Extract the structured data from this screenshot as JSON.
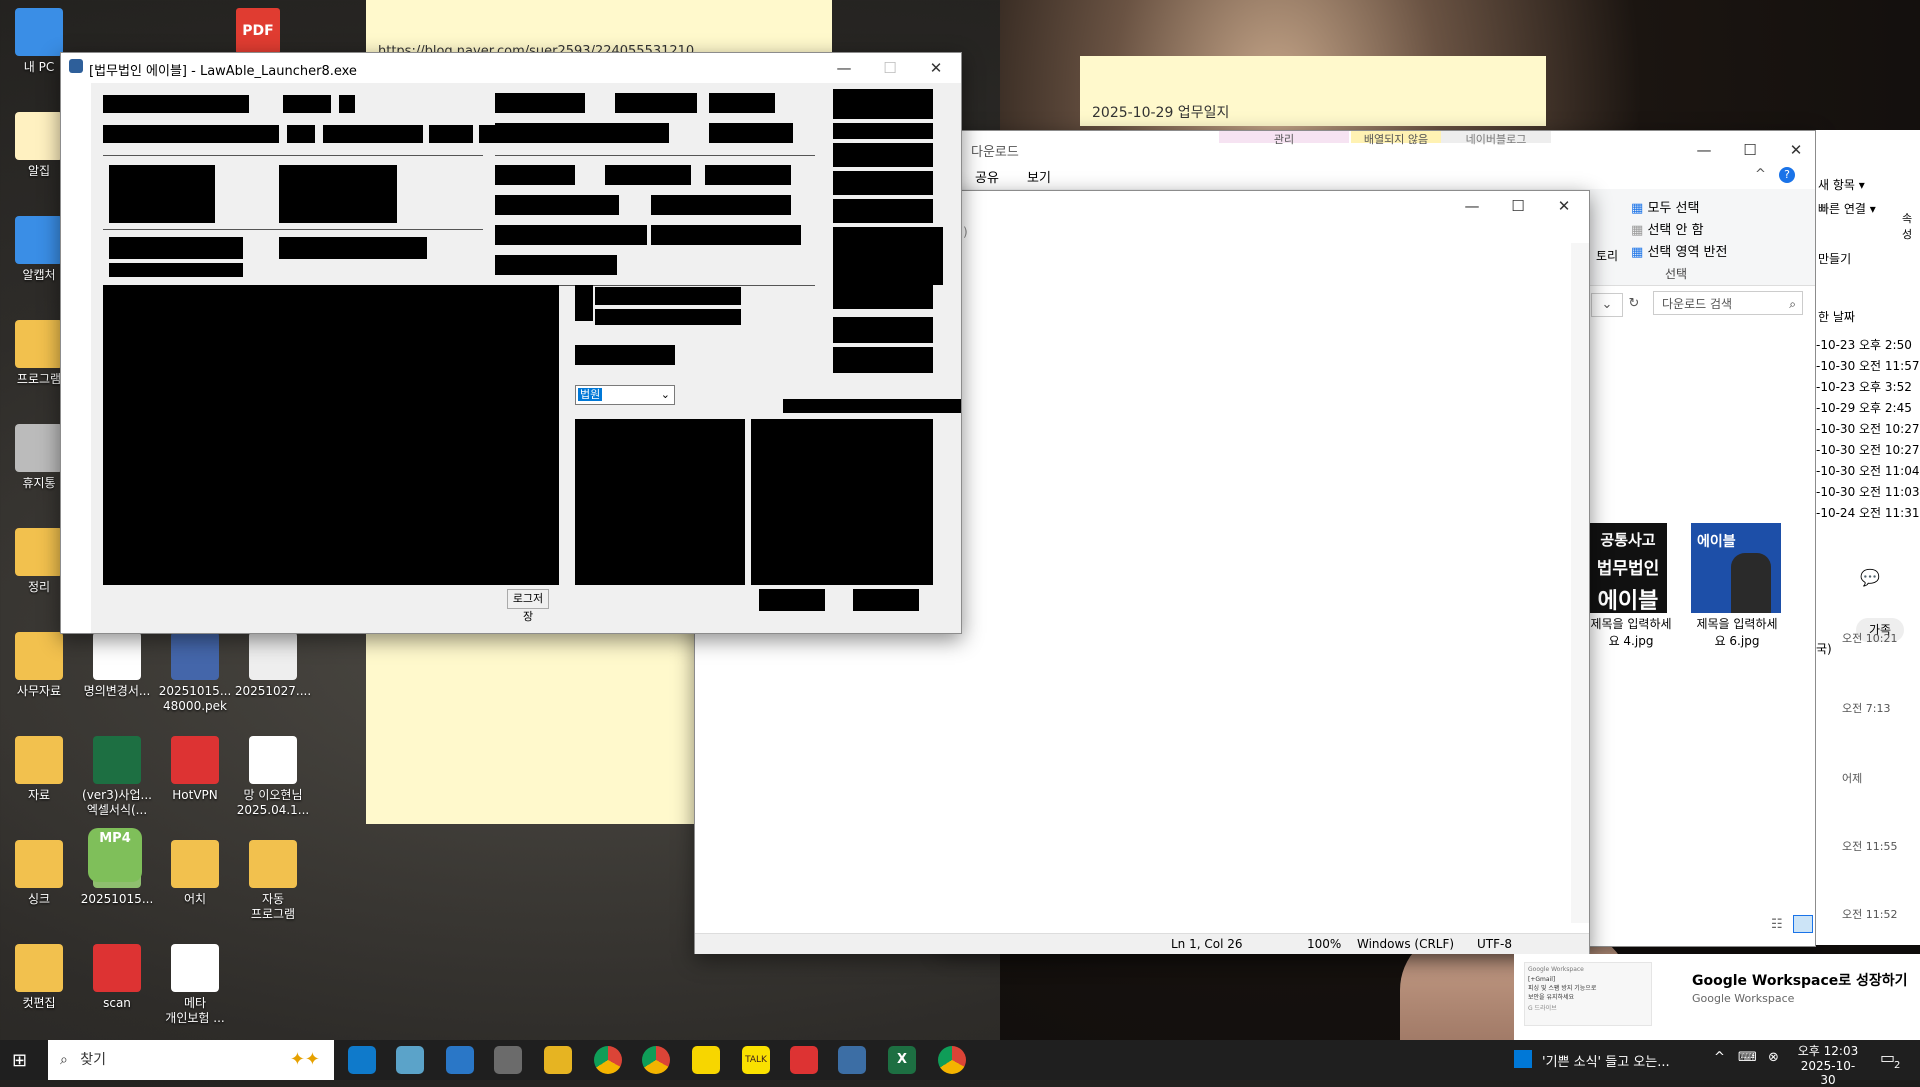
{
  "desktop": {
    "icons": [
      {
        "label": "내 PC"
      },
      {
        "label": "알집"
      },
      {
        "label": "알캡처"
      },
      {
        "label": "프로그램"
      },
      {
        "label": "휴지통"
      },
      {
        "label": "정리"
      },
      {
        "label": "사무자료"
      },
      {
        "label": "자료"
      },
      {
        "label": "싱크"
      },
      {
        "label": "컷편집"
      },
      {
        "label": "명의변경서..."
      },
      {
        "label": "(ver3)사업...\n엑셀서식(..."
      },
      {
        "label": "20251015..."
      },
      {
        "label": "scan"
      },
      {
        "label": "20251015...\n48000.pek"
      },
      {
        "label": "HotVPN"
      },
      {
        "label": "어치"
      },
      {
        "label": "메타\n개인보험 ..."
      },
      {
        "label": "20251027...."
      },
      {
        "label": "망 이오현님\n2025.04.1..."
      },
      {
        "label": "자동\n프로그램"
      }
    ],
    "top_icon_labels": {
      "pdf": "PDF",
      "mp4": "MP4"
    }
  },
  "sticky_notes": {
    "left_url": "https://blog.naver.com/suer2593/224055531210",
    "right_title": "2025-10-29 업무일지"
  },
  "launcher": {
    "title": "[법무법인 에이블] - LawAble_Launcher8.exe",
    "dropdown_value": "법원",
    "log_save_button": "로그저장"
  },
  "explorer": {
    "title": "다운로드",
    "tabs": [
      "공유",
      "보기"
    ],
    "ribbon_top_tabs": [
      "관리",
      "배열되지 않음",
      "네이버블로그"
    ],
    "select_group": {
      "label": "선택",
      "items": [
        "모두 선택",
        "선택 안 함",
        "선택 영역 반전"
      ]
    },
    "other_ribbon": [
      "새 항목 ▾",
      "빠른 연결 ▾",
      "만들기",
      "속성"
    ],
    "partial_ribbon_item": "토리",
    "search_placeholder": "다운로드 검색",
    "date_column": "한 날짜",
    "dates": [
      "-10-23 오후 2:50",
      "-10-30 오전 11:57",
      "-10-23 오후 3:52",
      "-10-29 오후 2:45",
      "-10-30 오전 10:27",
      "-10-30 오전 10:27",
      "-10-30 오전 11:04",
      "-10-30 오전 11:03",
      "-10-24 오전 11:31"
    ],
    "thumbnails": [
      {
        "caption": "제목을 입력하세\n요 4.jpg",
        "text1": "공통사고",
        "text2": "법무법인",
        "text3": "에이블"
      },
      {
        "caption": "제목을 입력하세\n요 6.jpg",
        "text1": "에이블"
      }
    ],
    "partial_text": ")"
  },
  "notepad": {
    "status": {
      "position": "Ln 1, Col 26",
      "zoom": "100%",
      "line_ending": "Windows (CRLF)",
      "encoding": "UTF-8"
    }
  },
  "chat_panel": {
    "family_button": "가족",
    "times": [
      "오전 10:21",
      "오전 7:13",
      "어제",
      "오전 11:55",
      "오전 11:52"
    ],
    "partial": "국)"
  },
  "notification": {
    "title": "Google Workspace로 성장하기",
    "source": "Google Workspace",
    "thumb_text1": "Google Workspace",
    "thumb_text2": "[+Gmail]\n피싱 및 스팸 방지 기능으로\n보안을 유지하세요",
    "thumb_text3": "G 드라이브"
  },
  "taskbar": {
    "search_placeholder": "찾기",
    "news_text": "'기쁜 소식' 들고 오는...",
    "time": "오후 12:03",
    "date": "2025-10-30",
    "badge": "2"
  },
  "colors": {
    "taskbar": "#1f1f1f",
    "note": "#fff9cc",
    "accent": "#0078d7"
  }
}
